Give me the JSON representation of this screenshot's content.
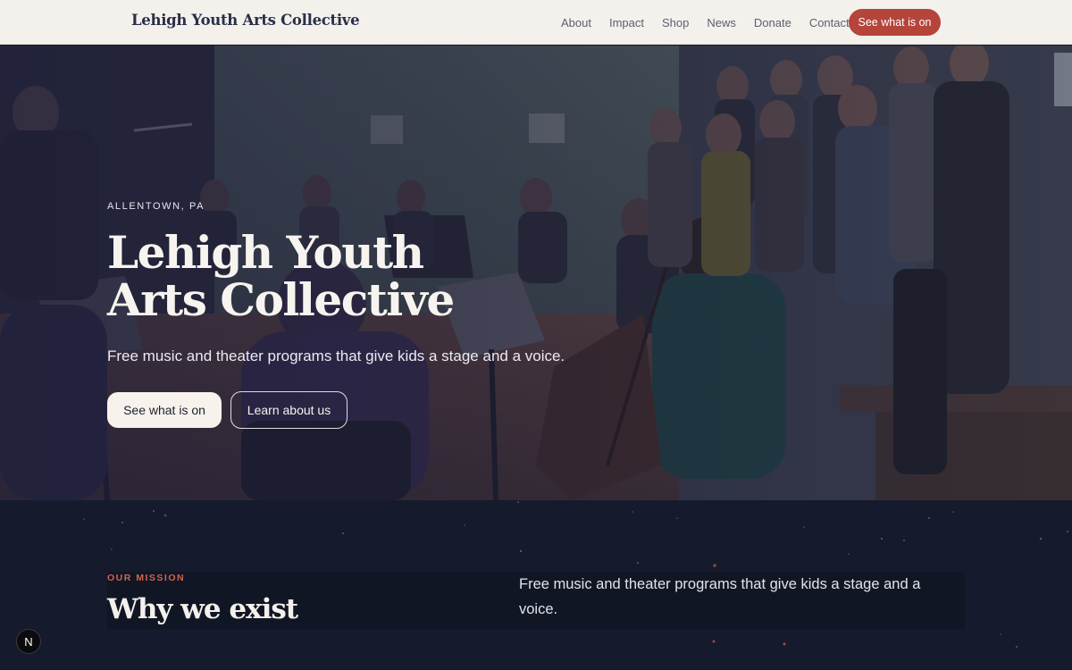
{
  "header": {
    "logo": "Lehigh Youth Arts Collective",
    "nav": [
      "About",
      "Impact",
      "Shop",
      "News",
      "Donate",
      "Contact"
    ],
    "cta": "See what is on"
  },
  "hero": {
    "eyebrow": "ALLENTOWN, PA",
    "title_line1": "Lehigh Youth",
    "title_line2": "Arts Collective",
    "subtitle": "Free music and theater programs that give kids a stage and a voice.",
    "primary_button": "See what is on",
    "secondary_button": "Learn about us"
  },
  "mission": {
    "eyebrow": "OUR MISSION",
    "title": "Why we exist",
    "text": "Free music and theater programs that give kids a stage and a voice."
  },
  "badge": {
    "label": "N"
  },
  "colors": {
    "accent": "#b5443a",
    "header_bg": "#f4f1ec",
    "dark_bg": "#151b2c",
    "eyebrow": "#d0634f"
  }
}
